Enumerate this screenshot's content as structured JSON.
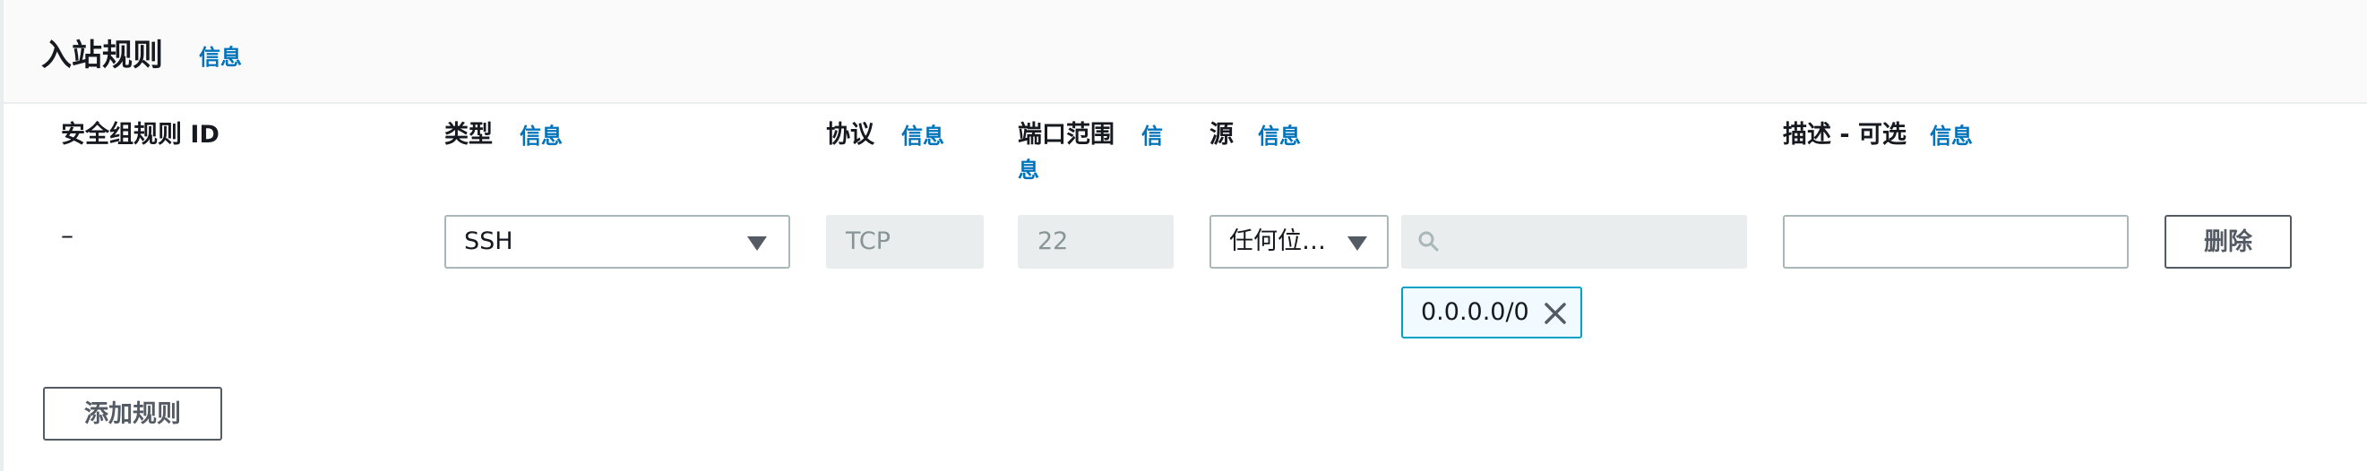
{
  "section": {
    "title": "入站规则",
    "info_link": "信息"
  },
  "columns": {
    "rule_id": "安全组规则 ID",
    "type": "类型",
    "type_info": "信息",
    "protocol": "协议",
    "protocol_info": "信息",
    "port_range": "端口范围",
    "port_range_info_line1": "信",
    "port_range_info_line2": "息",
    "source": "源",
    "source_info": "信息",
    "description": "描述 - 可选",
    "description_info": "信息"
  },
  "rule": {
    "id": "–",
    "type_value": "SSH",
    "protocol_value": "TCP",
    "port_value": "22",
    "source_type": "任何位…",
    "source_search_value": "",
    "description_value": "",
    "source_token": "0.0.0.0/0",
    "delete_label": "删除"
  },
  "actions": {
    "add_rule_label": "添加规则"
  },
  "colors": {
    "link": "#0073bb",
    "token_border": "#00a1c9",
    "disabled_bg": "#eaeded"
  }
}
